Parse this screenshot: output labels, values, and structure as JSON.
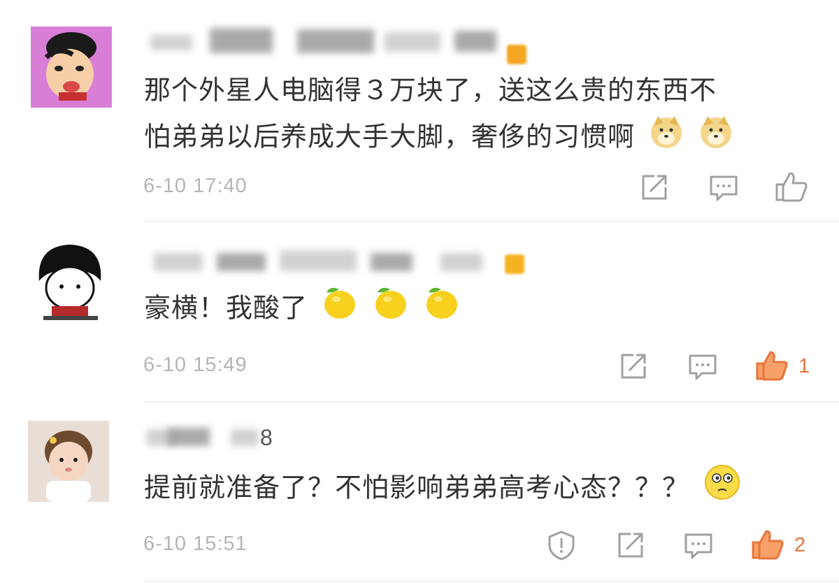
{
  "comments": [
    {
      "text_line1": "那个外星人电脑得３万块了，送这么贵的东西不",
      "text_line2": "怕弟弟以后养成大手大脚，奢侈的习惯啊",
      "emojis": [
        "doge-emoji",
        "doge-emoji"
      ],
      "time": "6-10 17:40",
      "like_count": "",
      "liked": false
    },
    {
      "text_line1": "豪横！我酸了",
      "emojis": [
        "lemon-emoji",
        "lemon-emoji",
        "lemon-emoji"
      ],
      "time": "6-10 15:49",
      "like_count": "1",
      "liked": true
    },
    {
      "username_tail": "8",
      "text_line1": "提前就准备了？不怕影响弟弟高考心态？？？",
      "emojis": [
        "thinking-face-emoji"
      ],
      "time": "6-10 15:51",
      "like_count": "2",
      "liked": true
    }
  ],
  "colors": {
    "text": "#333333",
    "timestamp": "#b5b5b5",
    "icon": "#a0a0a0",
    "like_active": "#e8743b",
    "badge": "#f5a623"
  }
}
